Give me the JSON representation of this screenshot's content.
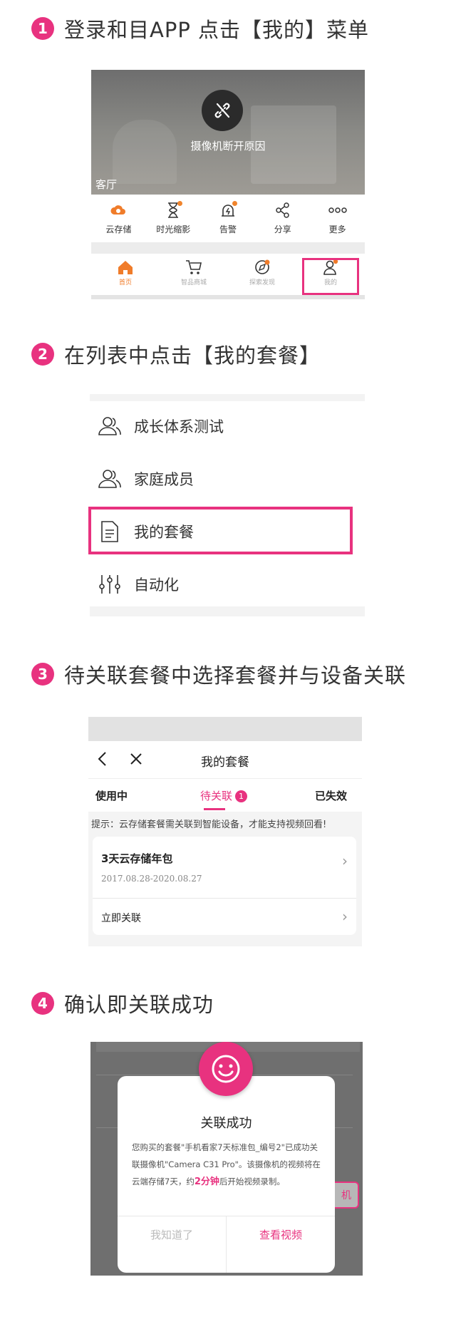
{
  "steps": [
    {
      "num": "1",
      "text": "登录和目APP  点击【我的】菜单"
    },
    {
      "num": "2",
      "text": "在列表中点击【我的套餐】"
    },
    {
      "num": "3",
      "text": "待关联套餐中选择套餐并与设备关联"
    },
    {
      "num": "4",
      "text": "确认即关联成功"
    }
  ],
  "panel1": {
    "disconnect_text": "摄像机断开原因",
    "room_label": "客厅",
    "functions": [
      {
        "label": "云存储",
        "icon": "cloud-icon"
      },
      {
        "label": "时光缩影",
        "icon": "hourglass-icon"
      },
      {
        "label": "告警",
        "icon": "alarm-icon"
      },
      {
        "label": "分享",
        "icon": "share-icon"
      },
      {
        "label": "更多",
        "icon": "more-icon"
      }
    ],
    "tabs": [
      {
        "label": "首页",
        "icon": "home-icon"
      },
      {
        "label": "智品商城",
        "icon": "cart-icon"
      },
      {
        "label": "探索发现",
        "icon": "explore-icon"
      },
      {
        "label": "我的",
        "icon": "profile-icon"
      }
    ]
  },
  "panel2": {
    "items": [
      {
        "label": "成长体系测试",
        "icon": "users-icon"
      },
      {
        "label": "家庭成员",
        "icon": "users-icon"
      },
      {
        "label": "我的套餐",
        "icon": "document-icon"
      },
      {
        "label": "自动化",
        "icon": "sliders-icon"
      }
    ]
  },
  "panel3": {
    "title": "我的套餐",
    "tabs": {
      "in_use": "使用中",
      "pending": "待关联",
      "pending_badge": "1",
      "expired": "已失效"
    },
    "hint": "提示：云存储套餐需关联到智能设备，才能支持视频回看!",
    "card": {
      "name": "3天云存储年包",
      "date_range": "2017.08.28-2020.08.27",
      "action": "立即关联"
    }
  },
  "panel4": {
    "title": "关联成功",
    "body_before": "您购买的套餐\"手机看家7天标准包_编号2\"已成功关联摄像机\"Camera C31 Pro\"。该摄像机的视频将在云端存储7天，约",
    "body_highlight": "2分钟",
    "body_after": "后开始视频录制。",
    "cancel_label": "我知道了",
    "ok_label": "查看视频",
    "peek_label": "机"
  },
  "colors": {
    "accent": "#e8327f",
    "orange": "#f07c2a"
  }
}
